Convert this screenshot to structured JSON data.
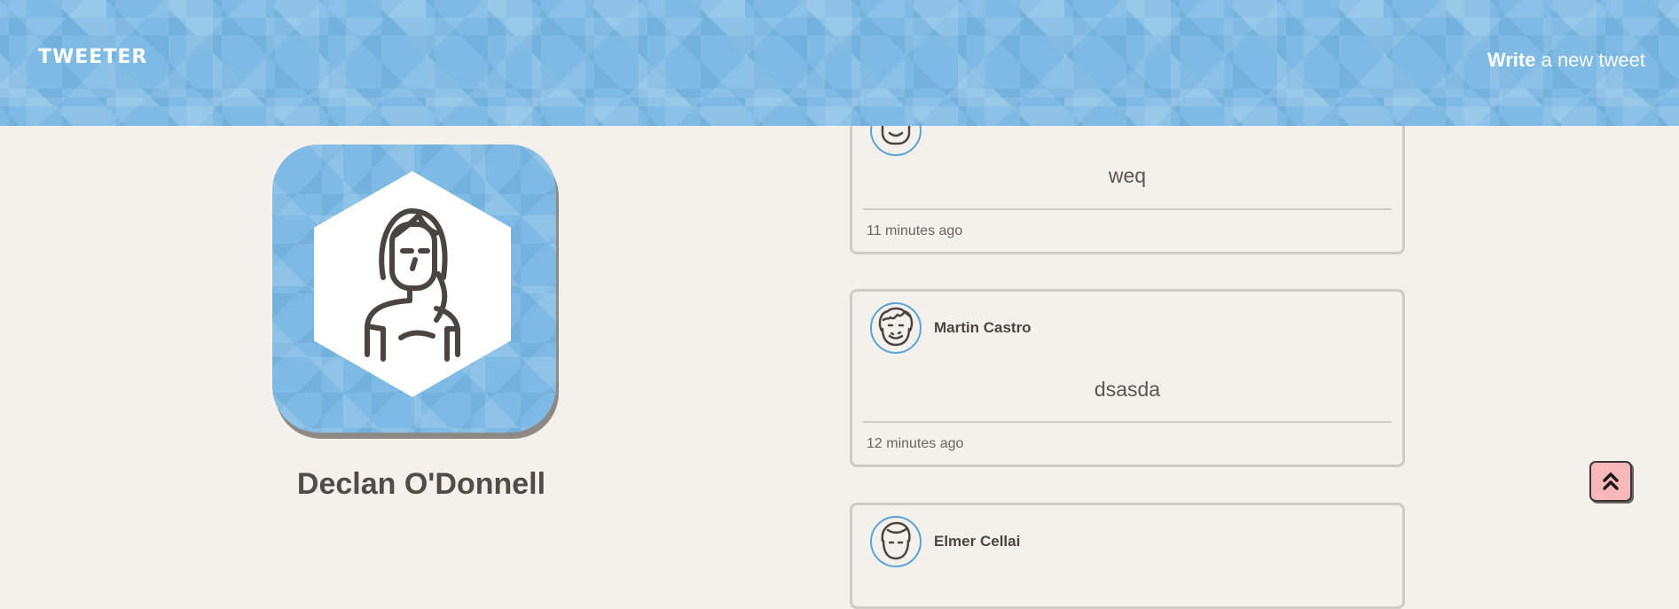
{
  "nav": {
    "brand": "TWEETER",
    "compose_bold": "Write",
    "compose_rest": "a new tweet"
  },
  "profile": {
    "name": "Declan O'Donnell"
  },
  "tweets": [
    {
      "author": "",
      "content": "weq",
      "time": "11 minutes ago"
    },
    {
      "author": "Martin Castro",
      "content": "dsasda",
      "time": "12 minutes ago"
    },
    {
      "author": "Elmer Cellai",
      "content": "",
      "time": ""
    }
  ],
  "colors": {
    "nav_bg": "#7ebae3",
    "page_bg": "#f4f1ec",
    "avatar_ring": "#5aa3d6",
    "scroll_top_bg": "#f6b8b8"
  },
  "icons": {
    "profile_avatar": "woman-avatar-icon",
    "scroll_top": "double-chevron-up-icon"
  }
}
